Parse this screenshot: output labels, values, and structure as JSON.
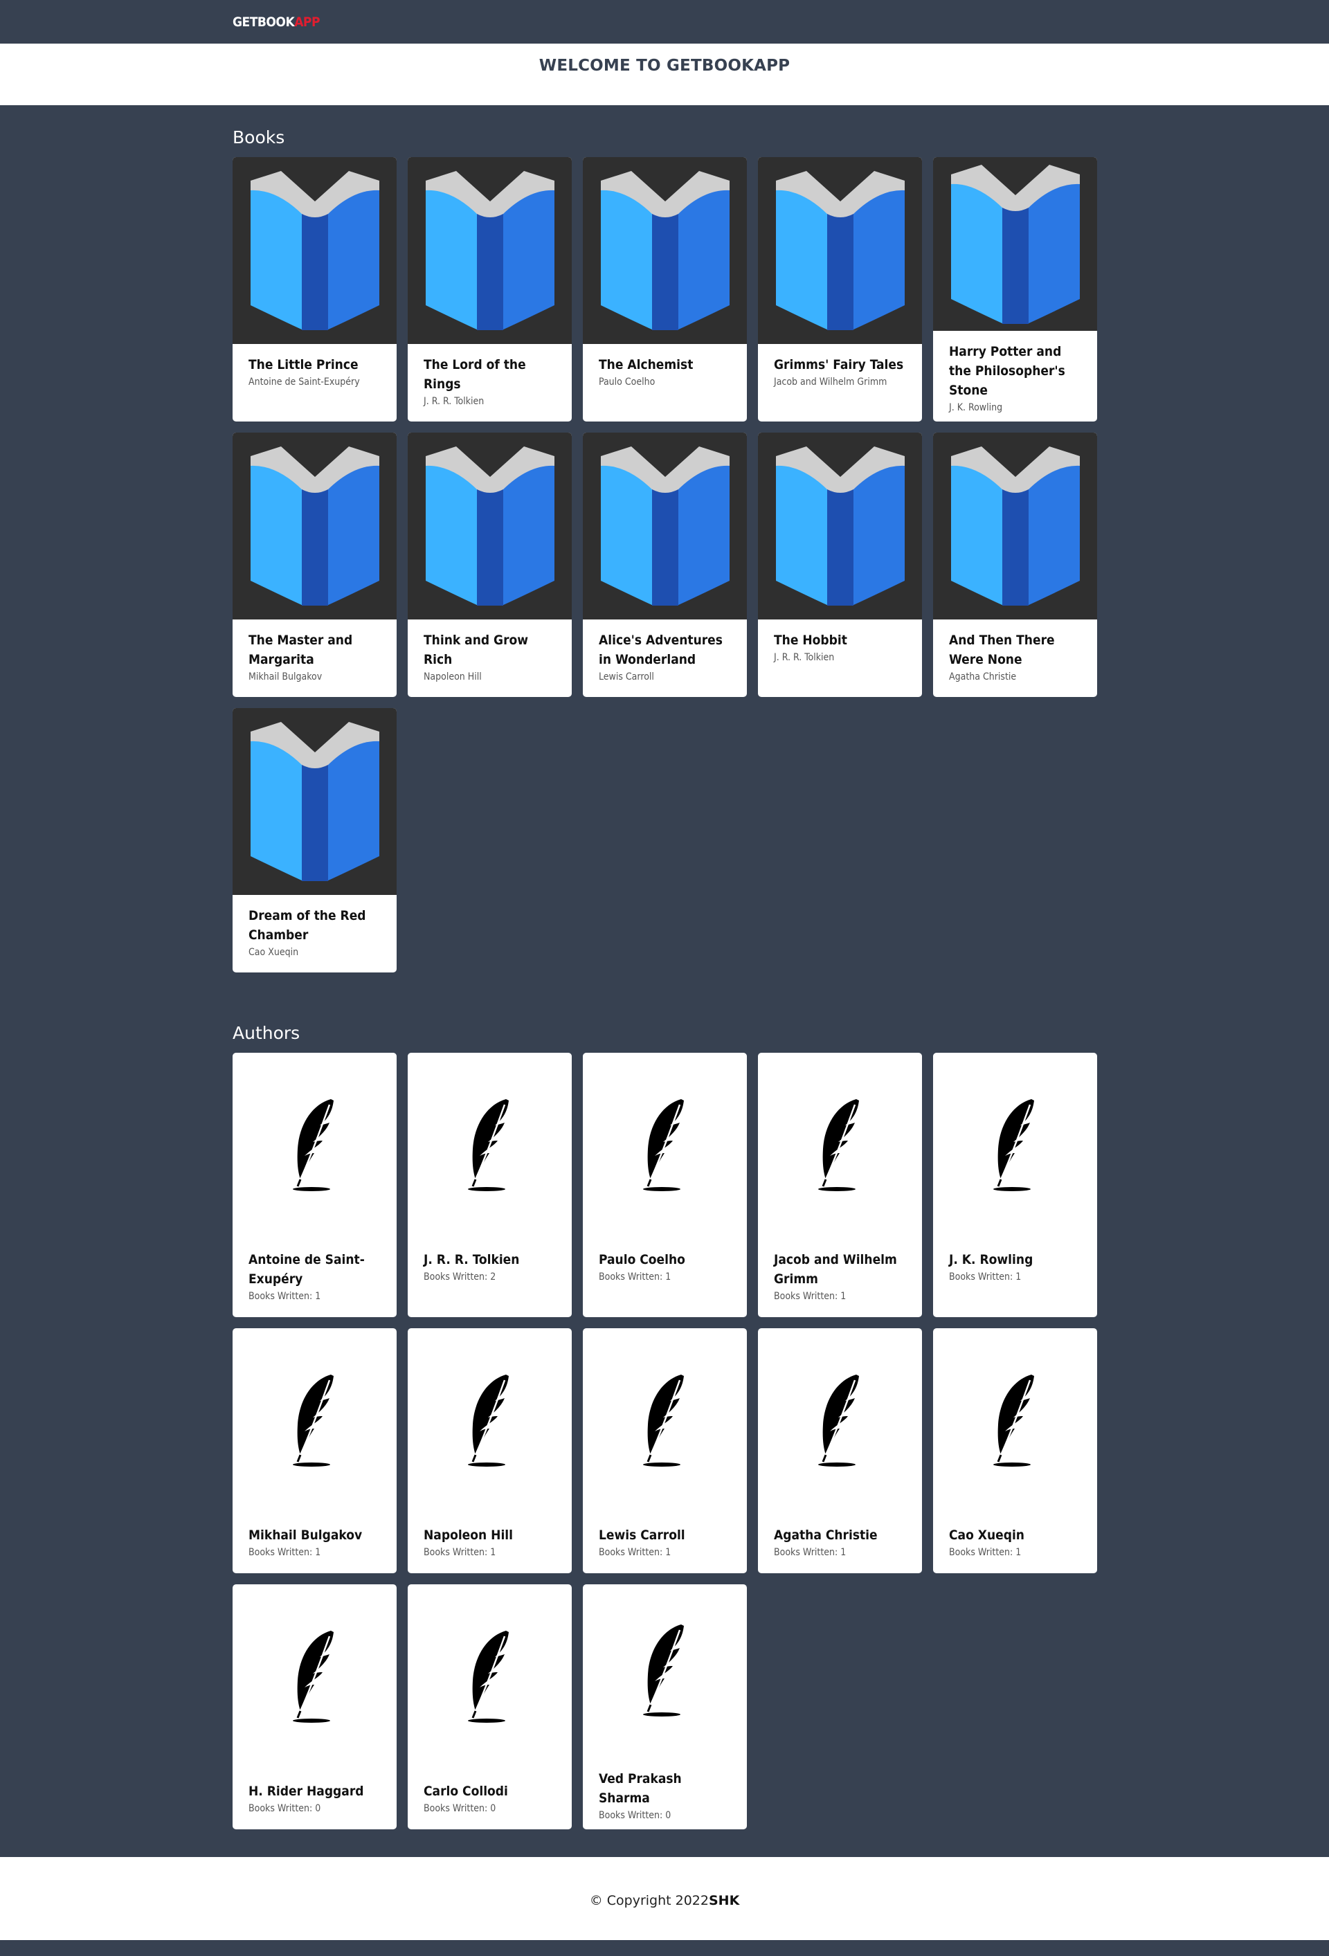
{
  "brand": {
    "part1": "GETBOOK",
    "part2": "APP"
  },
  "welcome": "WELCOME TO GETBOOKAPP",
  "books_title": "Books",
  "authors_title": "Authors",
  "books": [
    {
      "title": "The Little Prince",
      "author": "Antoine de Saint-Exupéry"
    },
    {
      "title": "The Lord of the Rings",
      "author": "J. R. R. Tolkien"
    },
    {
      "title": "The Alchemist",
      "author": "Paulo Coelho"
    },
    {
      "title": "Grimms' Fairy Tales",
      "author": "Jacob and Wilhelm Grimm"
    },
    {
      "title": "Harry Potter and the Philosopher's Stone",
      "author": "J. K. Rowling"
    },
    {
      "title": "The Master and Margarita",
      "author": "Mikhail Bulgakov"
    },
    {
      "title": "Think and Grow Rich",
      "author": "Napoleon Hill"
    },
    {
      "title": "Alice's Adventures in Wonderland",
      "author": "Lewis Carroll"
    },
    {
      "title": "The Hobbit",
      "author": "J. R. R. Tolkien"
    },
    {
      "title": "And Then There Were None",
      "author": "Agatha Christie"
    },
    {
      "title": "Dream of the Red Chamber",
      "author": "Cao Xueqin"
    }
  ],
  "authors": [
    {
      "name": "Antoine de Saint-Exupéry",
      "books": "Books Written: 1"
    },
    {
      "name": "J. R. R. Tolkien",
      "books": "Books Written: 2"
    },
    {
      "name": "Paulo Coelho",
      "books": "Books Written: 1"
    },
    {
      "name": "Jacob and Wilhelm Grimm",
      "books": "Books Written: 1"
    },
    {
      "name": "J. K. Rowling",
      "books": "Books Written: 1"
    },
    {
      "name": "Mikhail Bulgakov",
      "books": "Books Written: 1"
    },
    {
      "name": "Napoleon Hill",
      "books": "Books Written: 1"
    },
    {
      "name": "Lewis Carroll",
      "books": "Books Written: 1"
    },
    {
      "name": "Agatha Christie",
      "books": "Books Written: 1"
    },
    {
      "name": "Cao Xueqin",
      "books": "Books Written: 1"
    },
    {
      "name": "H. Rider Haggard",
      "books": "Books Written: 0"
    },
    {
      "name": "Carlo Collodi",
      "books": "Books Written: 0"
    },
    {
      "name": "Ved Prakash Sharma",
      "books": "Books Written: 0"
    }
  ],
  "footer": {
    "copyright": "© Copyright 2022 ",
    "owner": "SHK"
  },
  "icons": {
    "book_cover": "open-book-icon",
    "author": "quill-feather-icon"
  },
  "colors": {
    "background": "#374151",
    "brand_accent": "#e11d2f",
    "book_blue_light": "#3bb2ff",
    "book_blue_dark": "#2b78e4"
  }
}
